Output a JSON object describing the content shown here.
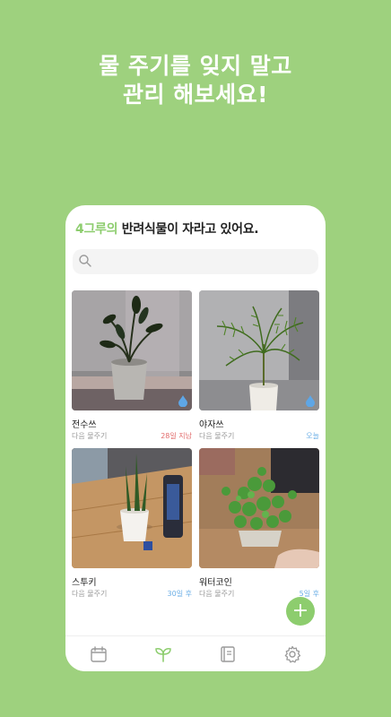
{
  "headline": {
    "line1": "물 주기를 잊지 말고",
    "line2": "관리 해보세요!"
  },
  "screen": {
    "title_count": "4그루의",
    "title_rest": " 반려식물이 자라고 있어요.",
    "search_placeholder": "",
    "plants": [
      {
        "name": "전수쓰",
        "next_label": "다음 물주기",
        "due": "28일 지남",
        "due_color": "#e26b6b",
        "photo": "zz-plant-in-metal-bucket",
        "water_icon": true
      },
      {
        "name": "야자쓰",
        "next_label": "다음 물주기",
        "due": "오늘",
        "due_color": "#6aaee6",
        "photo": "palm-in-white-pot",
        "water_icon": true
      },
      {
        "name": "스투키",
        "next_label": "다음 물주기",
        "due": "30일 후",
        "due_color": "#6aaee6",
        "photo": "stucky-on-wood-table",
        "water_icon": false
      },
      {
        "name": "워터코인",
        "next_label": "다음 물주기",
        "due": "5일 후",
        "due_color": "#6aaee6",
        "photo": "water-coin-pot",
        "water_icon": false
      }
    ],
    "fab_label": "+",
    "nav": [
      "calendar-icon",
      "sprout-icon",
      "notebook-icon",
      "gear-icon"
    ],
    "accent_color": "#8dcd6e",
    "background_color": "#9ed17e"
  }
}
